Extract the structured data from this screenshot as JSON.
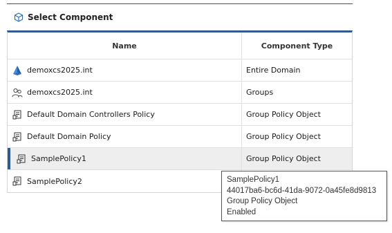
{
  "header": {
    "title": "Select Component",
    "icon": "cube-icon"
  },
  "table": {
    "columns": [
      "Name",
      "Component Type"
    ],
    "rows": [
      {
        "name": "demoxcs2025.int",
        "type": "Entire Domain",
        "icon": "domain-icon"
      },
      {
        "name": "demoxcs2025.int",
        "type": "Groups",
        "icon": "groups-icon"
      },
      {
        "name": "Default Domain Controllers Policy",
        "type": "Group Policy Object",
        "icon": "policy-icon"
      },
      {
        "name": "Default Domain Policy",
        "type": "Group Policy Object",
        "icon": "policy-icon"
      },
      {
        "name": "SamplePolicy1",
        "type": "Group Policy Object",
        "icon": "policy-icon",
        "selected": true
      },
      {
        "name": "SamplePolicy2",
        "type": "",
        "icon": "policy-icon"
      }
    ]
  },
  "tooltip": {
    "line1": "SamplePolicy1",
    "line2": "44017ba6-bc6d-41da-9072-0a45fe8d9813",
    "line3": "Group Policy Object",
    "line4": "Enabled"
  },
  "colors": {
    "accent": "#2f5b92",
    "selected_bg": "#eeeeee"
  }
}
